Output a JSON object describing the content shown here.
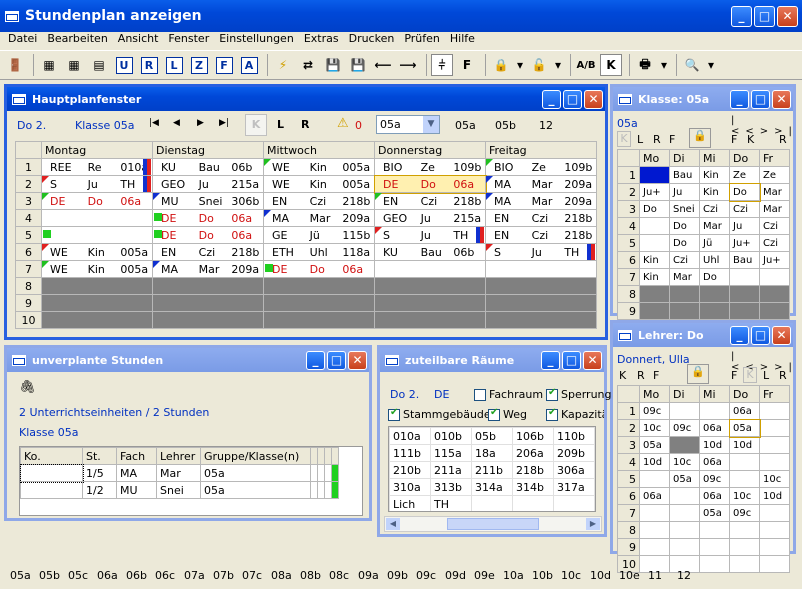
{
  "app": {
    "title": "Stundenplan anzeigen"
  },
  "menu": [
    "Datei",
    "Bearbeiten",
    "Ansicht",
    "Fenster",
    "Einstellungen",
    "Extras",
    "Drucken",
    "Prüfen",
    "Hilfe"
  ],
  "toolbar": {
    "letters": [
      "U",
      "R",
      "L",
      "Z",
      "F",
      "A"
    ],
    "f_label": "F",
    "k_label": "K",
    "ab_label": "A/B"
  },
  "haupt": {
    "title": "Hauptplanfenster",
    "day": "Do 2.",
    "klasse_label": "Klasse 05a",
    "nav": [
      "|◀",
      "◀",
      "▶",
      "▶|"
    ],
    "klr": [
      "K",
      "L",
      "R"
    ],
    "warn_count": "0",
    "select": "05a",
    "classes": [
      "05a",
      "05b",
      "12"
    ],
    "days": [
      "Montag",
      "Dienstag",
      "Mittwoch",
      "Donnerstag",
      "Freitag"
    ],
    "rows": [
      [
        [
          "REE",
          "Re",
          "010a"
        ],
        [
          "KU",
          "Bau",
          "06b"
        ],
        [
          "WE",
          "Kin",
          "005a"
        ],
        [
          "BIO",
          "Ze",
          "109b"
        ],
        [
          "BIO",
          "Ze",
          "109b"
        ]
      ],
      [
        [
          "S",
          "Ju",
          "TH"
        ],
        [
          "GEO",
          "Ju",
          "215a"
        ],
        [
          "WE",
          "Kin",
          "005a"
        ],
        [
          "DE",
          "Do",
          "06a"
        ],
        [
          "MA",
          "Mar",
          "209a"
        ]
      ],
      [
        [
          "DE",
          "Do",
          "06a"
        ],
        [
          "MU",
          "Snei",
          "306b"
        ],
        [
          "EN",
          "Czi",
          "218b"
        ],
        [
          "EN",
          "Czi",
          "218b"
        ],
        [
          "MA",
          "Mar",
          "209a"
        ]
      ],
      [
        [
          "",
          "",
          ""
        ],
        [
          "DE",
          "Do",
          "06a"
        ],
        [
          "MA",
          "Mar",
          "209a"
        ],
        [
          "GEO",
          "Ju",
          "215a"
        ],
        [
          "EN",
          "Czi",
          "218b"
        ]
      ],
      [
        [
          "",
          "",
          ""
        ],
        [
          "DE",
          "Do",
          "06a"
        ],
        [
          "GE",
          "Jü",
          "115b"
        ],
        [
          "S",
          "Ju",
          "TH"
        ],
        [
          "EN",
          "Czi",
          "218b"
        ]
      ],
      [
        [
          "WE",
          "Kin",
          "005a"
        ],
        [
          "EN",
          "Czi",
          "218b"
        ],
        [
          "ETH",
          "Uhl",
          "118a"
        ],
        [
          "KU",
          "Bau",
          "06b"
        ],
        [
          "S",
          "Ju",
          "TH"
        ]
      ],
      [
        [
          "WE",
          "Kin",
          "005a"
        ],
        [
          "MA",
          "Mar",
          "209a"
        ],
        [
          "DE",
          "Do",
          "06a"
        ],
        [
          "",
          "",
          ""
        ],
        [
          "",
          "",
          ""
        ]
      ]
    ],
    "row_nums": [
      "1",
      "2",
      "3",
      "4",
      "5",
      "6",
      "7",
      "8",
      "9",
      "10"
    ]
  },
  "klasse": {
    "title": "Klasse: 05a",
    "label": "05a",
    "nav": [
      "|<",
      "<",
      ">",
      ">|"
    ],
    "k": "K",
    "l": "L",
    "r": "R",
    "f": "F",
    "days": [
      "Mo",
      "Di",
      "Mi",
      "Do",
      "Fr"
    ],
    "rows": [
      [
        "",
        "Bau",
        "Kin",
        "Ze",
        "Ze"
      ],
      [
        "Ju+",
        "Ju",
        "Kin",
        "Do",
        "Mar"
      ],
      [
        "Do",
        "Snei",
        "Czi",
        "Czi",
        "Mar"
      ],
      [
        "",
        "Do",
        "Mar",
        "Ju",
        "Czi"
      ],
      [
        "",
        "Do",
        "Jü",
        "Ju+",
        "Czi"
      ],
      [
        "Kin",
        "Czi",
        "Uhl",
        "Bau",
        "Ju+"
      ],
      [
        "Kin",
        "Mar",
        "Do",
        "",
        ""
      ],
      [
        "",
        "",
        "",
        "",
        ""
      ],
      [
        "",
        "",
        "",
        "",
        ""
      ],
      [
        "",
        "",
        "",
        "",
        ""
      ]
    ]
  },
  "lehrer": {
    "title": "Lehrer: Do",
    "name": "Donnert, Ulla",
    "nav": [
      "|<",
      "<",
      ">",
      ">|"
    ],
    "k": "K",
    "r": "R",
    "f": "F",
    "l": "L",
    "days": [
      "Mo",
      "Di",
      "Mi",
      "Do",
      "Fr"
    ],
    "rows": [
      [
        "09c",
        "",
        "",
        "06a",
        ""
      ],
      [
        "10c",
        "09c",
        "06a",
        "05a",
        ""
      ],
      [
        "05a",
        "",
        "10d",
        "10d",
        ""
      ],
      [
        "10d",
        "10c",
        "06a",
        "",
        ""
      ],
      [
        "",
        "05a",
        "09c",
        "",
        "10c"
      ],
      [
        "06a",
        "",
        "06a",
        "10c",
        "10d"
      ],
      [
        "",
        "",
        "05a",
        "09c",
        ""
      ],
      [
        "",
        "",
        "",
        "",
        ""
      ],
      [
        "",
        "",
        "",
        "",
        ""
      ],
      [
        "",
        "",
        "",
        "",
        ""
      ]
    ]
  },
  "unverplant": {
    "title": "unverplante Stunden",
    "summary": "2 Unterrichtseinheiten / 2 Stunden",
    "klasse": "Klasse 05a",
    "cols": [
      "Ko.",
      "St.",
      "Fach",
      "Lehrer",
      "Gruppe/Klasse(n)"
    ],
    "rows": [
      [
        "",
        "1/5",
        "MA",
        "Mar",
        "05a"
      ],
      [
        "",
        "1/2",
        "MU",
        "Snei",
        "05a"
      ]
    ]
  },
  "raeume": {
    "title": "zuteilbare Räume",
    "day": "Do 2.",
    "fach": "DE",
    "checks": [
      {
        "label": "Fachraum",
        "on": false
      },
      {
        "label": "Sperrung",
        "on": true
      },
      {
        "label": "Stammgebäude",
        "on": true
      },
      {
        "label": "Weg",
        "on": true
      },
      {
        "label": "Kapazität",
        "on": true
      }
    ],
    "rooms": [
      [
        "010a",
        "010b",
        "05b",
        "106b",
        "110b"
      ],
      [
        "111b",
        "115a",
        "18a",
        "206a",
        "209b"
      ],
      [
        "210b",
        "211a",
        "211b",
        "218b",
        "306a"
      ],
      [
        "310a",
        "313b",
        "314a",
        "314b",
        "317a"
      ],
      [
        "Lich",
        "TH",
        "",
        "",
        ""
      ]
    ]
  },
  "status": [
    "05a",
    "05b",
    "05c",
    "06a",
    "06b",
    "06c",
    "07a",
    "07b",
    "07c",
    "08a",
    "08b",
    "08c",
    "09a",
    "09b",
    "09c",
    "09d",
    "09e",
    "10a",
    "10b",
    "10c",
    "10d",
    "10e",
    "11",
    "12"
  ]
}
